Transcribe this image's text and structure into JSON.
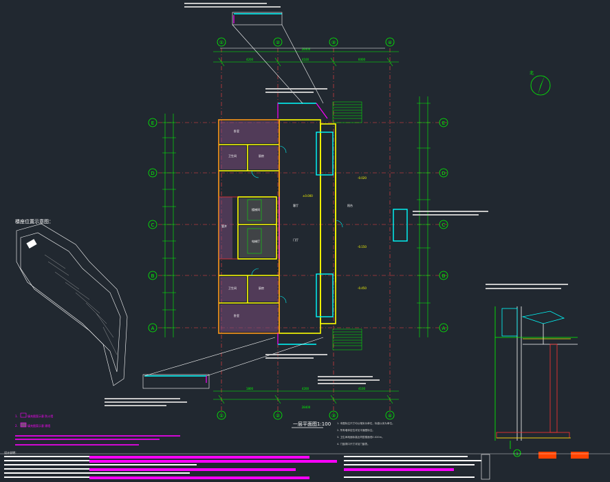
{
  "drawing": {
    "grid_cols": [
      "①",
      "②",
      "③",
      "④"
    ],
    "grid_rows": [
      "E",
      "D",
      "C",
      "B",
      "A"
    ],
    "plan_title": "一层平面图1:100",
    "north_label": "北",
    "site_plan_title": "楼座位置示意图：",
    "section_number": "1",
    "dim_top_total": "28400",
    "dim_bottom_total": "28400",
    "dim_segments": [
      "4200",
      "4100",
      "6000",
      "1800",
      "4200",
      "4100"
    ],
    "legend_items": [
      {
        "num": "1.",
        "text": "填充图案示意 防火墙"
      },
      {
        "num": "2.",
        "text": "填充图案示意 隔墙"
      }
    ],
    "notes_header": "设计说明：",
    "plan_notes": [
      "1. 本图标注尺寸均以毫米为单位，标高以米为单位。",
      "2. 所有墙体定位详见平面图标注。",
      "3. 卫生间地面标高比同层楼面低0.020m。",
      "4. 门窗洞口尺寸详见门窗表。"
    ],
    "room_labels": [
      "卧室",
      "卫生间",
      "厨房",
      "客厅",
      "楼梯间",
      "电梯厅",
      "管井",
      "门厅",
      "阳台"
    ],
    "elevation_marks": [
      "±0.000",
      "-0.020",
      "-0.150",
      "-0.450"
    ],
    "colors": {
      "background": "#212830",
      "axis": "#00ff00",
      "wall": "#ffff00",
      "window": "#00ffff",
      "dimension": "#00ff00",
      "text": "#ffffff",
      "accent": "#ff00ff",
      "hatch": "#ff3333"
    }
  }
}
